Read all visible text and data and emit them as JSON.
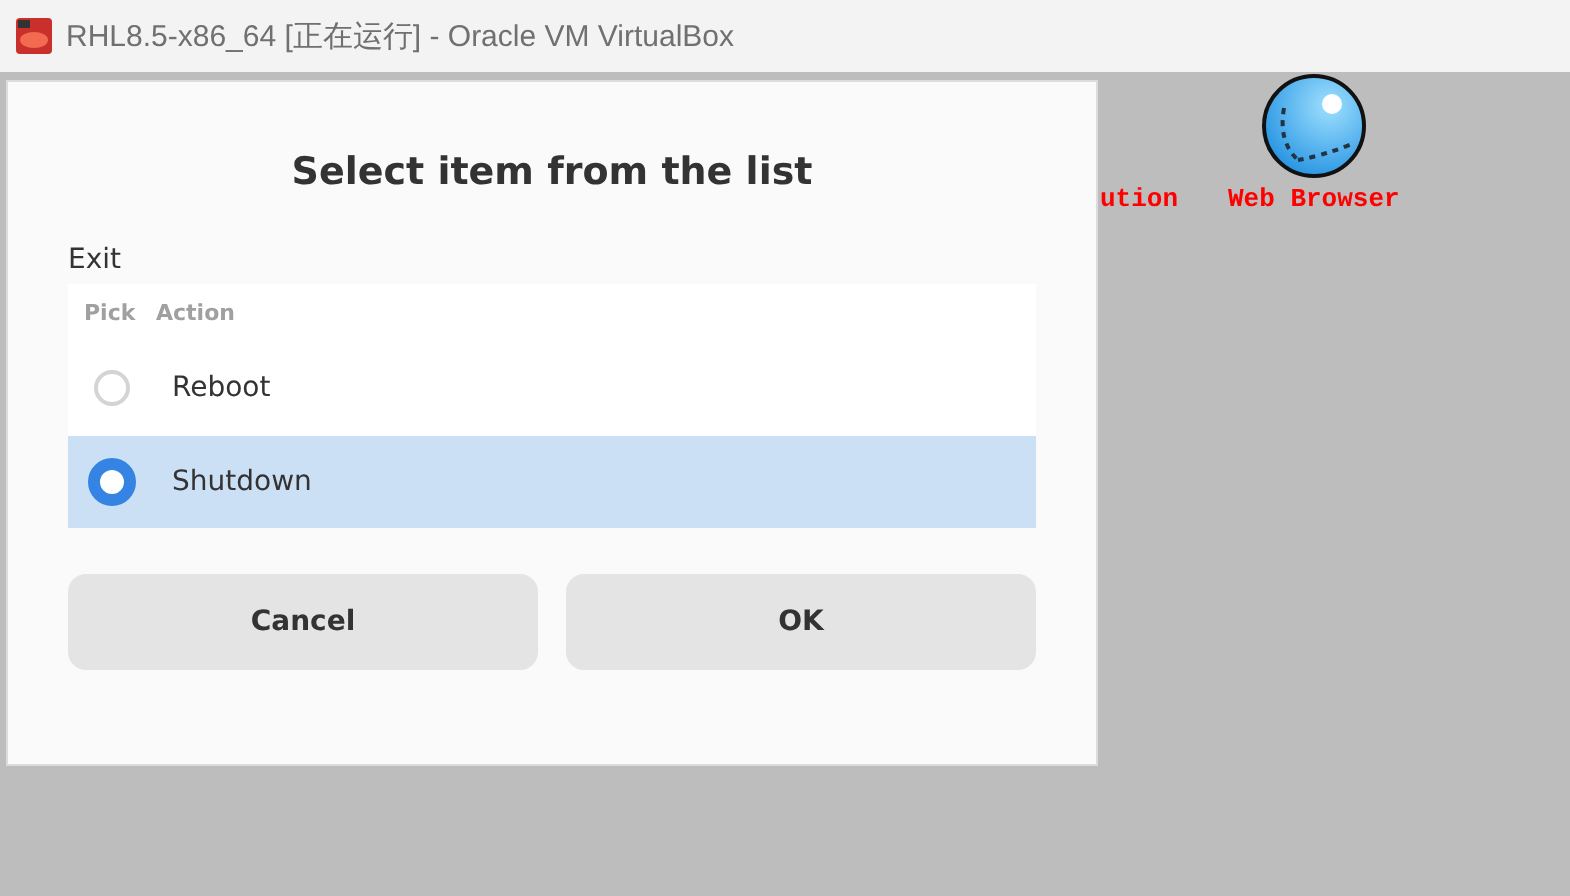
{
  "window": {
    "title": "RHL8.5-x86_64 [正在运行] - Oracle VM VirtualBox"
  },
  "desktop": {
    "icons": [
      {
        "label": "ution",
        "kind": "partial"
      },
      {
        "label": "Web Browser",
        "kind": "globe"
      }
    ]
  },
  "dialog": {
    "title": "Select item from the list",
    "prompt": "Exit",
    "columns": [
      "Pick",
      "Action"
    ],
    "rows": [
      {
        "action": "Reboot",
        "selected": false
      },
      {
        "action": "Shutdown",
        "selected": true
      }
    ],
    "buttons": [
      "Cancel",
      "OK"
    ]
  }
}
